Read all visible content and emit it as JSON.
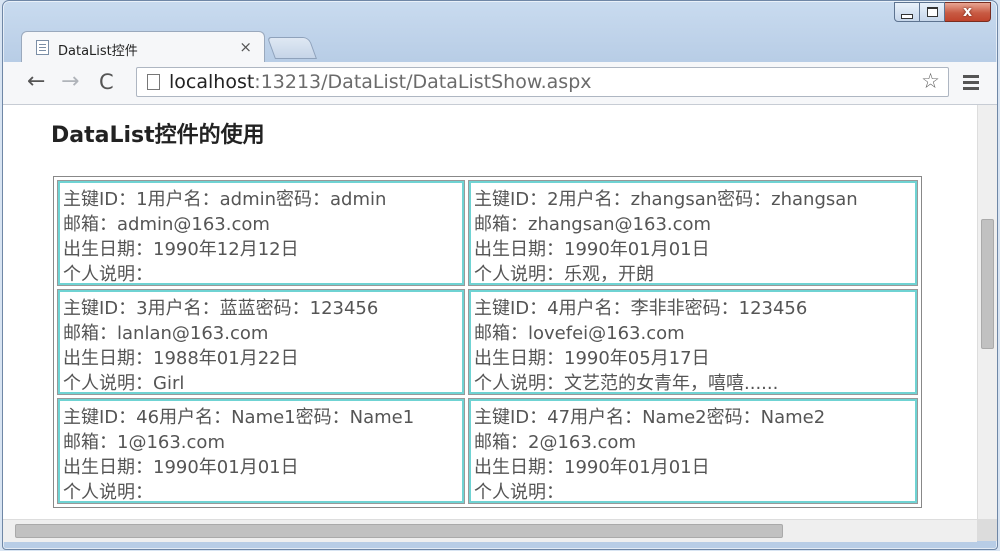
{
  "window": {
    "caption_buttons": [
      "minimize-icon",
      "maximize-icon",
      "close-icon"
    ],
    "close_glyph": "x"
  },
  "tab": {
    "title": "DataList控件",
    "close_glyph": "×"
  },
  "toolbar": {
    "back_glyph": "←",
    "forward_glyph": "→",
    "reload_glyph": "C",
    "url_host": "localhost",
    "url_rest": ":13213/DataList/DataListShow.aspx",
    "star_glyph": "☆"
  },
  "page": {
    "title": "DataList控件的使用"
  },
  "datalist": {
    "rows": [
      [
        {
          "line1": "主键ID：1用户名：admin密码：admin",
          "line2": "邮箱：admin@163.com",
          "line3": "出生日期：1990年12月12日",
          "line4": "个人说明："
        },
        {
          "line1": "主键ID：2用户名：zhangsan密码：zhangsan",
          "line2": "邮箱：zhangsan@163.com",
          "line3": "出生日期：1990年01月01日",
          "line4": "个人说明：乐观，开朗"
        }
      ],
      [
        {
          "line1": "主键ID：3用户名：蓝蓝密码：123456",
          "line2": "邮箱：lanlan@163.com",
          "line3": "出生日期：1988年01月22日",
          "line4": "个人说明：Girl"
        },
        {
          "line1": "主键ID：4用户名：李非非密码：123456",
          "line2": "邮箱：lovefei@163.com",
          "line3": "出生日期：1990年05月17日",
          "line4": "个人说明：文艺范的女青年，嘻嘻......"
        }
      ],
      [
        {
          "line1": "主键ID：46用户名：Name1密码：Name1",
          "line2": "邮箱：1@163.com",
          "line3": "出生日期：1990年01月01日",
          "line4": "个人说明："
        },
        {
          "line1": "主键ID：47用户名：Name2密码：Name2",
          "line2": "邮箱：2@163.com",
          "line3": "出生日期：1990年01月01日",
          "line4": "个人说明："
        }
      ]
    ]
  },
  "colors": {
    "item_border": "#6fd3d3",
    "item_text": "#555555"
  }
}
